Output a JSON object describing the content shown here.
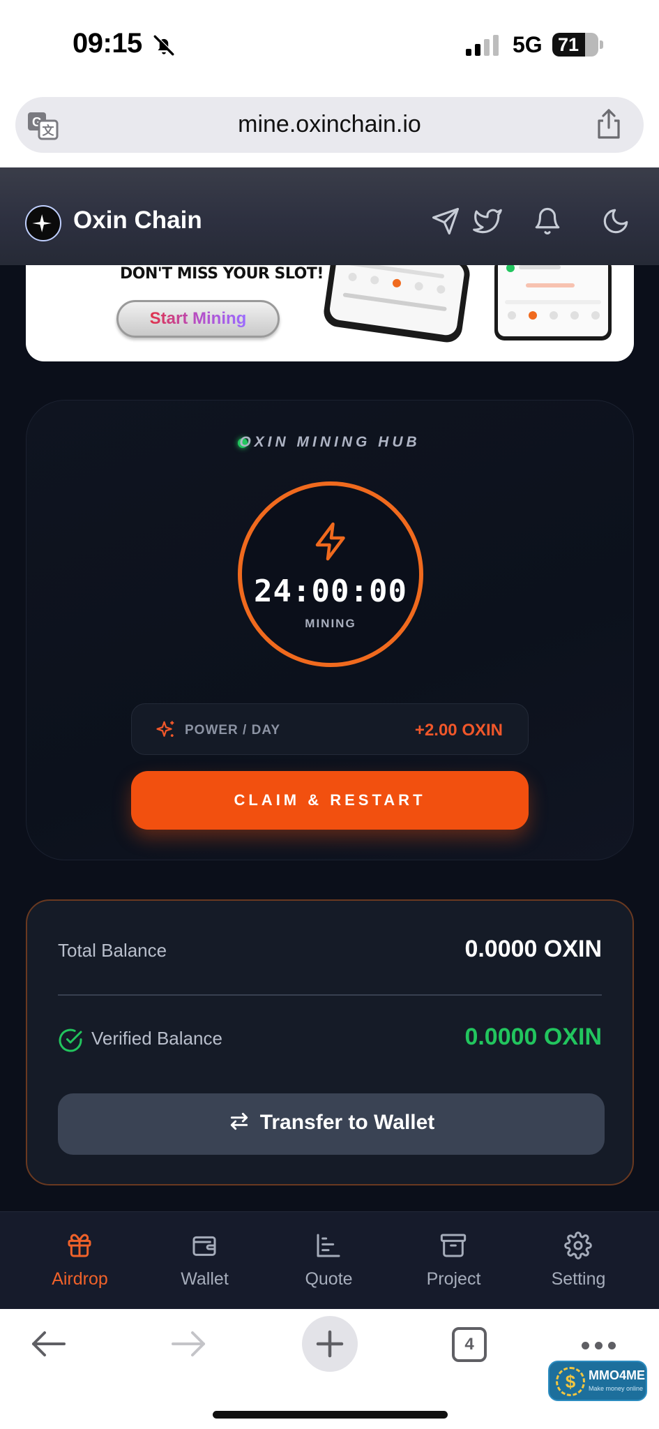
{
  "status_bar": {
    "time": "09:15",
    "network": "5G",
    "battery_level": "71",
    "battery_fraction": 0.71
  },
  "browser": {
    "url": "mine.oxinchain.io",
    "open_tabs": "4"
  },
  "app_header": {
    "brand": "Oxin Chain",
    "icons": [
      "telegram-icon",
      "twitter-icon",
      "bell-icon",
      "moon-icon"
    ]
  },
  "banner": {
    "slogan": "DON'T MISS YOUR SLOT!",
    "cta": "Start Mining"
  },
  "mining_hub": {
    "title": "OXIN MINING HUB",
    "timer": "24:00:00",
    "state": "MINING",
    "power_label": "POWER / DAY",
    "power_value": "+2.00 OXIN",
    "claim_button": "CLAIM & RESTART"
  },
  "balance": {
    "total_label": "Total Balance",
    "total_value": "0.0000 OXIN",
    "verified_label": "Verified Balance",
    "verified_value": "0.0000 OXIN",
    "transfer_button": "Transfer to Wallet"
  },
  "bottom_nav": {
    "items": [
      {
        "label": "Airdrop",
        "icon": "gift-icon",
        "active": true
      },
      {
        "label": "Wallet",
        "icon": "wallet-icon",
        "active": false
      },
      {
        "label": "Quote",
        "icon": "chart-icon",
        "active": false
      },
      {
        "label": "Project",
        "icon": "archive-icon",
        "active": false
      },
      {
        "label": "Setting",
        "icon": "gear-icon",
        "active": false
      }
    ]
  },
  "watermark": {
    "title": "MMO4ME",
    "subtitle": "Make money online",
    "symbol": "$"
  },
  "colors": {
    "accent_orange": "#f2500f",
    "timer_ring": "#f06a1e",
    "verified_green": "#22c55e",
    "background": "#0b0f1a"
  }
}
